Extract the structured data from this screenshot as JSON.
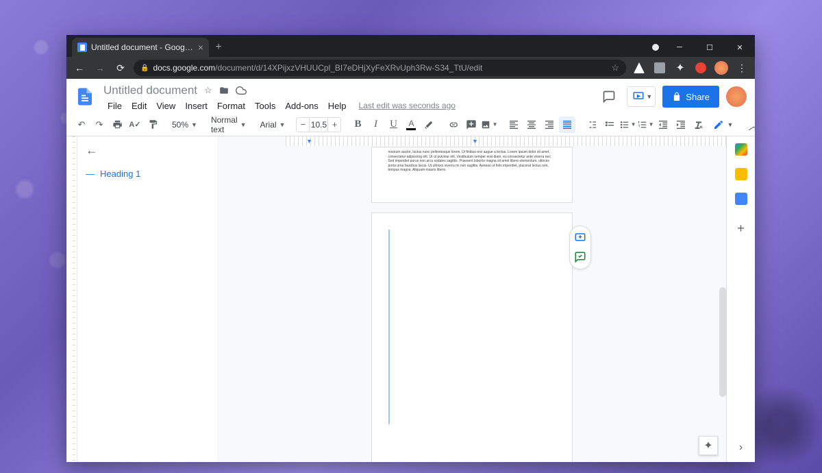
{
  "browser": {
    "tab_title": "Untitled document - Google Docs",
    "url_display_prefix": "docs.google.com",
    "url_display_path": "/document/d/14XPijxzVHUUCpl_BI7eDHjXyFeXRvUph3Rw-S34_TtU/edit"
  },
  "doc": {
    "title": "Untitled document",
    "last_edit": "Last edit was seconds ago",
    "menus": [
      "File",
      "Edit",
      "View",
      "Insert",
      "Format",
      "Tools",
      "Add-ons",
      "Help"
    ],
    "share_label": "Share"
  },
  "toolbar": {
    "zoom": "50%",
    "style": "Normal text",
    "font": "Arial",
    "font_size": "10.5"
  },
  "outline": {
    "items": [
      "Heading 1"
    ]
  },
  "page1_text": "nostrum auctor, luctus nunc pellentesque lorem. Ut finibus orci augue a lectus.\nLorem ipsum dolor sit amet, consectetur adipiscing elit. Ut ut pulvinar elit. Vestibulum semper erat diam, eu consectetur ante viverra nec. Sed imperdiet purus non arcu sodales sagittis. Praesent lobortis magna sit amet libero elementum, ultrices porta urna faucibus lacus. Ut ultrices viverra mi non sagittis. Aenean ut felis imperdiet, placerat lectus non, tempus magna. Aliquam mauris libero."
}
